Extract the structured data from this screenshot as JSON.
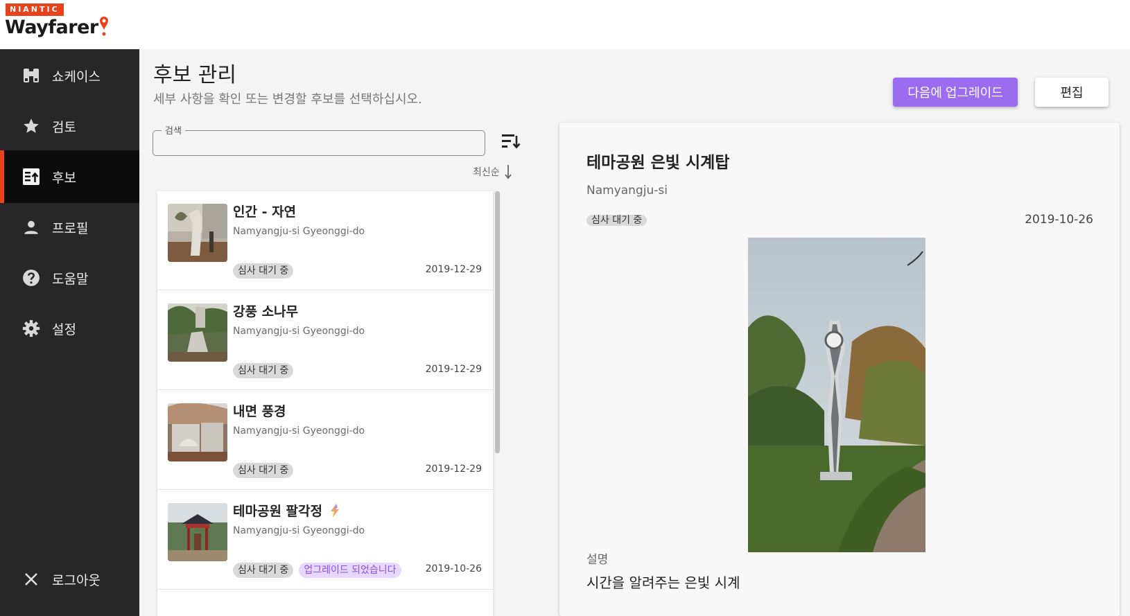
{
  "brand": {
    "company": "NIANTIC",
    "product": "Wayfarer"
  },
  "sidebar": {
    "items": [
      {
        "label": "쇼케이스",
        "icon": "binoculars-icon"
      },
      {
        "label": "검토",
        "icon": "star-icon"
      },
      {
        "label": "후보",
        "icon": "upload-list-icon",
        "active": true
      },
      {
        "label": "프로필",
        "icon": "person-icon"
      },
      {
        "label": "도움말",
        "icon": "help-circle-icon"
      },
      {
        "label": "설정",
        "icon": "gear-icon"
      }
    ],
    "logout": {
      "label": "로그아웃",
      "icon": "close-icon"
    }
  },
  "header": {
    "title": "후보 관리",
    "subtitle": "세부 사항을 확인 또는 변경할 후보를 선택하십시오.",
    "upgrade_button": "다음에 업그레이드",
    "edit_button": "편집"
  },
  "search": {
    "legend": "검색",
    "value": "",
    "placeholder": ""
  },
  "sort": {
    "label": "최신순"
  },
  "nominations": [
    {
      "title": "인간 - 자연",
      "location": "Namyangju-si Gyeonggi-do",
      "status": "심사 대기 중",
      "date": "2019-12-29"
    },
    {
      "title": "강풍 소나무",
      "location": "Namyangju-si Gyeonggi-do",
      "status": "심사 대기 중",
      "date": "2019-12-29"
    },
    {
      "title": "내면 풍경",
      "location": "Namyangju-si Gyeonggi-do",
      "status": "심사 대기 중",
      "date": "2019-12-29"
    },
    {
      "title": "테마공원 팔각정",
      "location": "Namyangju-si Gyeonggi-do",
      "status": "심사 대기 중",
      "upgrade_tag": "업그레이드 되었습니다",
      "date": "2019-10-26",
      "upgraded": true
    }
  ],
  "detail": {
    "title": "테마공원 은빛 시계탑",
    "location": "Namyangju-si",
    "status": "심사 대기 중",
    "date": "2019-10-26",
    "description_label": "설명",
    "description": "시간을 알려주는 은빛 시계"
  },
  "colors": {
    "accent": "#e8431d",
    "upgrade": "#9b6cf0",
    "sidebar": "#272727"
  }
}
